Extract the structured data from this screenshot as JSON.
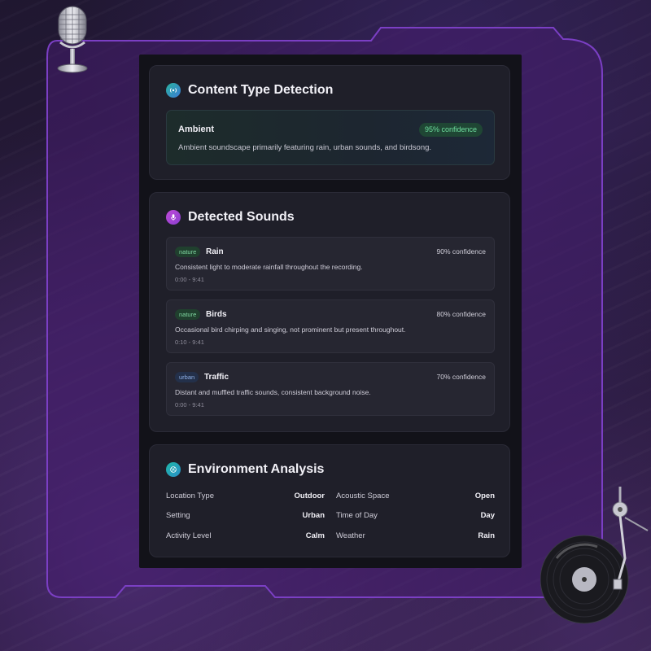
{
  "content_type": {
    "title": "Content Type Detection",
    "name": "Ambient",
    "confidence": "95% confidence",
    "description": "Ambient soundscape primarily featuring rain, urban sounds, and birdsong."
  },
  "sounds": {
    "title": "Detected Sounds",
    "items": [
      {
        "tag": "nature",
        "name": "Rain",
        "confidence": "90% confidence",
        "description": "Consistent light to moderate rainfall throughout the recording.",
        "time": "0:00 - 9:41"
      },
      {
        "tag": "nature",
        "name": "Birds",
        "confidence": "80% confidence",
        "description": "Occasional bird chirping and singing, not prominent but present throughout.",
        "time": "0:10 - 9:41"
      },
      {
        "tag": "urban",
        "name": "Traffic",
        "confidence": "70% confidence",
        "description": "Distant and muffled traffic sounds, consistent background noise.",
        "time": "0:00 - 9:41"
      }
    ]
  },
  "environment": {
    "title": "Environment Analysis",
    "left": [
      {
        "label": "Location Type",
        "value": "Outdoor"
      },
      {
        "label": "Setting",
        "value": "Urban"
      },
      {
        "label": "Activity Level",
        "value": "Calm"
      }
    ],
    "right": [
      {
        "label": "Acoustic Space",
        "value": "Open"
      },
      {
        "label": "Time of Day",
        "value": "Day"
      },
      {
        "label": "Weather",
        "value": "Rain"
      }
    ]
  },
  "colors": {
    "accent_frame": "#7b3fc4",
    "badge_green": "#6fe0a0",
    "tag_urban": "#8fb0e6"
  },
  "icons": {
    "content_type": "broadcast-icon",
    "sounds": "microphone-icon",
    "environment": "globe-icon",
    "decor_top_left": "microphone-icon",
    "decor_bottom_right": "turntable-icon"
  }
}
